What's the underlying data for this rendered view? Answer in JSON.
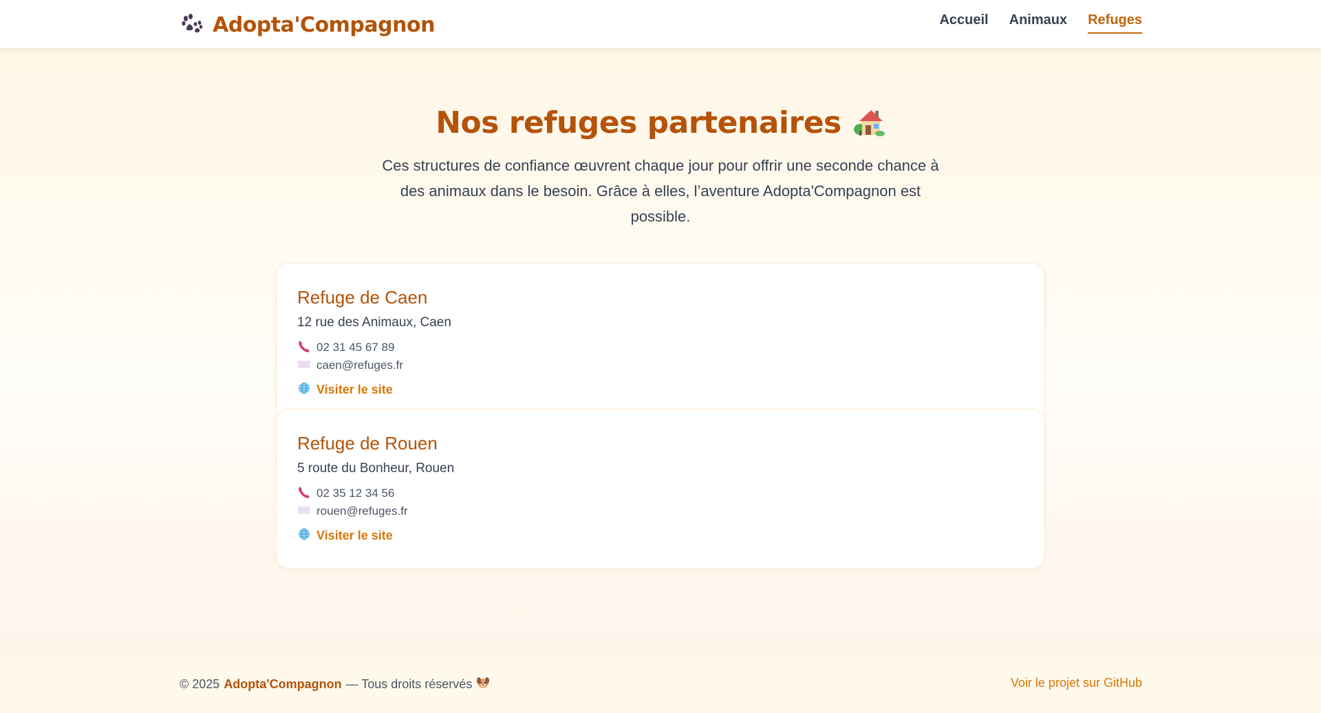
{
  "header": {
    "brand": "Adopta'Compagnon",
    "brand_icon": "paw-icon",
    "nav": [
      {
        "label": "Accueil",
        "active": false
      },
      {
        "label": "Animaux",
        "active": false
      },
      {
        "label": "Refuges",
        "active": true
      }
    ]
  },
  "main": {
    "title": "Nos refuges partenaires",
    "title_icon": "house-icon",
    "subtitle": "Ces structures de confiance œuvrent chaque jour pour offrir une seconde chance à des animaux dans le besoin. Grâce à elles, l’aventure Adopta'Compagnon est possible.",
    "shelters": [
      {
        "name": "Refuge de Caen",
        "address": "12 rue des Animaux, Caen",
        "phone": "02 31 45 67 89",
        "email": "caen@refuges.fr",
        "link_label": "Visiter le site"
      },
      {
        "name": "Refuge de Rouen",
        "address": "5 route du Bonheur, Rouen",
        "phone": "02 35 12 34 56",
        "email": "rouen@refuges.fr",
        "link_label": "Visiter le site"
      }
    ]
  },
  "footer": {
    "copyright": "© 2025",
    "brand": "Adopta'Compagnon",
    "rights": "— Tous droits réservés",
    "rights_icon": "dog-face-icon",
    "github_link": "Voir le projet sur GitHub"
  },
  "colors": {
    "brand": "#b45309",
    "accent": "#d97706",
    "text": "#374151",
    "background": "#fff9ef"
  }
}
